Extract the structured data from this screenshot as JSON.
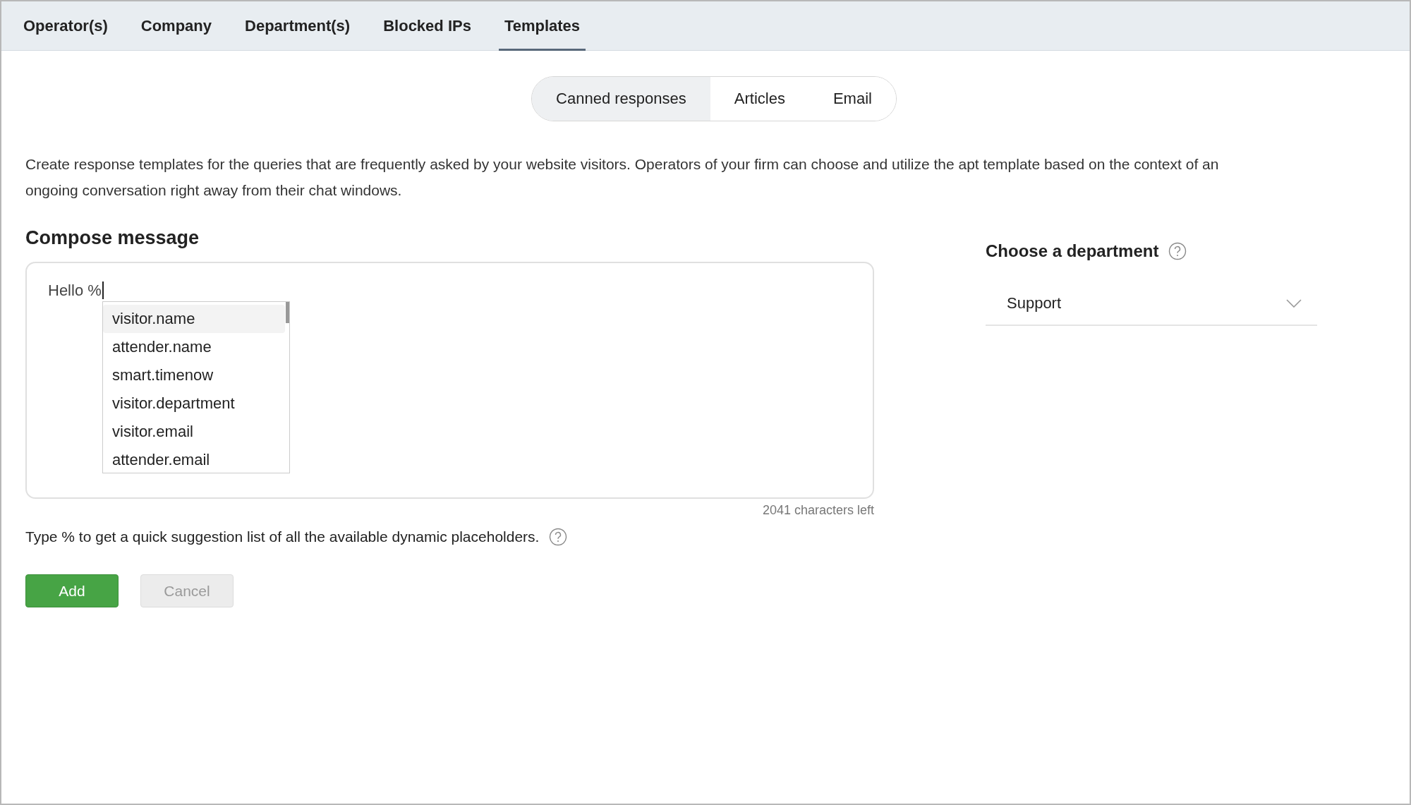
{
  "tabs": [
    {
      "label": "Operator(s)",
      "selected": false
    },
    {
      "label": "Company",
      "selected": false
    },
    {
      "label": "Department(s)",
      "selected": false
    },
    {
      "label": "Blocked IPs",
      "selected": false
    },
    {
      "label": "Templates",
      "selected": true
    }
  ],
  "segments": [
    {
      "label": "Canned responses",
      "selected": true
    },
    {
      "label": "Articles",
      "selected": false
    },
    {
      "label": "Email",
      "selected": false
    }
  ],
  "description": "Create response templates for the queries that are frequently asked by your website visitors. Operators of your firm can choose and utilize the apt template based on the context of an ongoing conversation right away from their chat windows.",
  "compose": {
    "title": "Compose message",
    "value": "Hello %",
    "suggestions": [
      {
        "label": "visitor.name",
        "selected": true
      },
      {
        "label": "attender.name",
        "selected": false
      },
      {
        "label": "smart.timenow",
        "selected": false
      },
      {
        "label": "visitor.department",
        "selected": false
      },
      {
        "label": "visitor.email",
        "selected": false
      },
      {
        "label": "attender.email",
        "selected": false
      }
    ],
    "counter": "2041 characters left",
    "hint": "Type % to get a quick suggestion list of all the available dynamic placeholders."
  },
  "buttons": [
    {
      "label": "Add",
      "kind": "primary",
      "disabled": false
    },
    {
      "label": "Cancel",
      "kind": "secondary",
      "disabled": true
    }
  ],
  "department": {
    "title": "Choose a department",
    "value": "Support"
  }
}
